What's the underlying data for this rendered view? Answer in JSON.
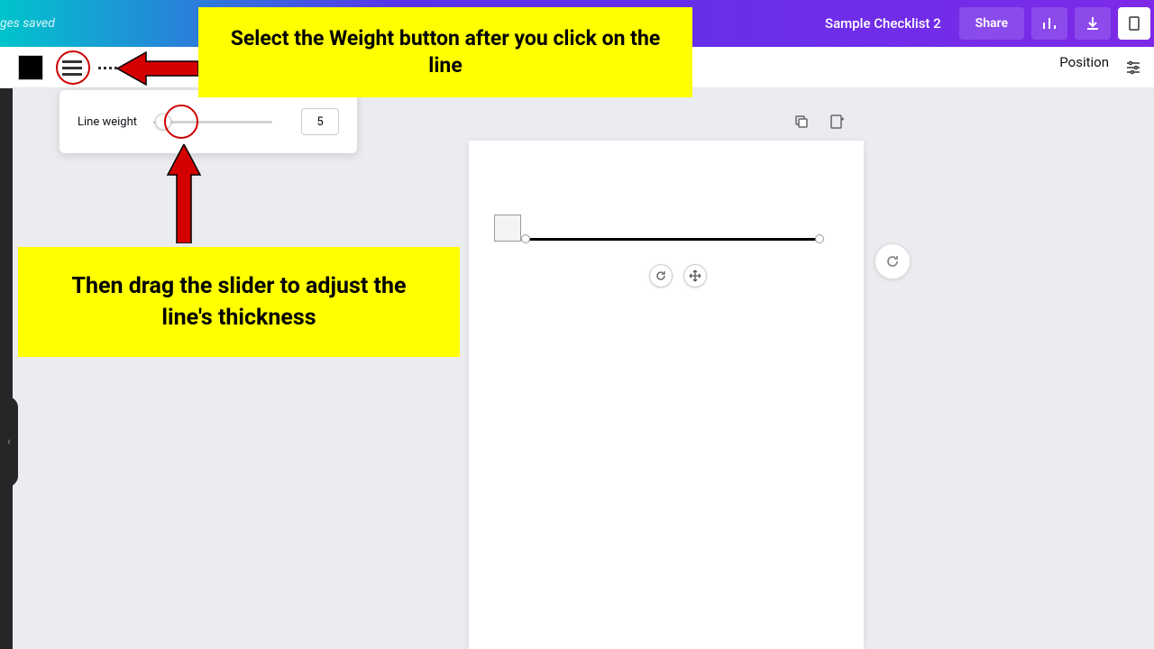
{
  "header": {
    "saved_status": "ges saved",
    "doc_title": "Sample Checklist 2",
    "share_label": "Share"
  },
  "toolbar": {
    "position_label": "Position"
  },
  "weight_panel": {
    "label": "Line weight",
    "value": "5"
  },
  "callouts": {
    "c1": "Select the Weight button after you click on the line",
    "c2": "Then drag the slider to adjust the line's thickness"
  }
}
